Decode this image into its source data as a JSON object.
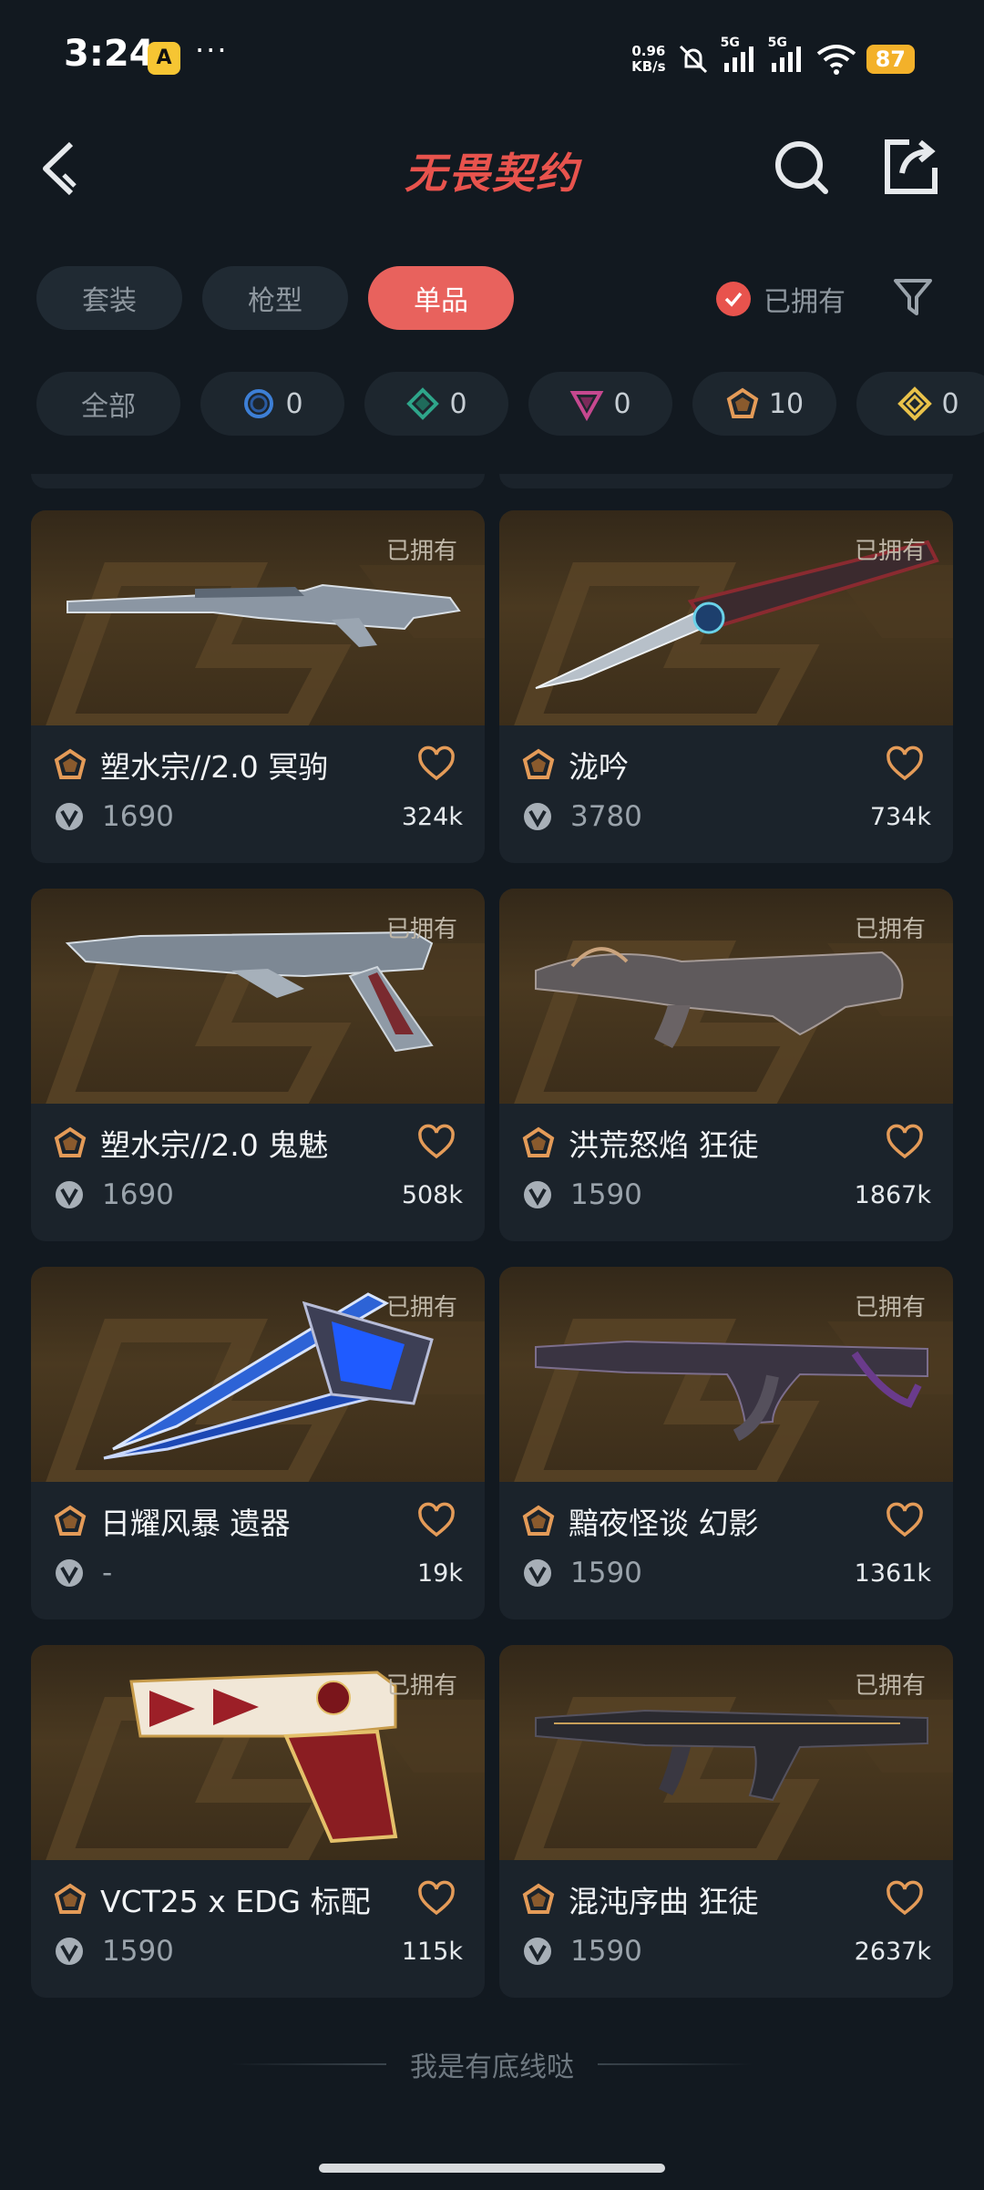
{
  "status_bar": {
    "time": "3:24",
    "app_badge": "A",
    "more": "···",
    "net_speed_value": "0.96",
    "net_speed_unit": "KB/s",
    "signal_1": "5G",
    "signal_2": "5G",
    "battery": "87"
  },
  "header": {
    "title": "无畏契约",
    "brand_color": "#e8534d"
  },
  "tabs": [
    {
      "label": "套装",
      "active": false
    },
    {
      "label": "枪型",
      "active": false
    },
    {
      "label": "单品",
      "active": true
    }
  ],
  "owned_filter": {
    "label": "已拥有",
    "checked": true
  },
  "rarity_filters": [
    {
      "label": "全部"
    },
    {
      "count": "0",
      "icon": "select-tier-icon",
      "color": "#3d7fd6"
    },
    {
      "count": "0",
      "icon": "deluxe-tier-icon",
      "color": "#2ea58a"
    },
    {
      "count": "0",
      "icon": "premium-tier-icon",
      "color": "#c6488f"
    },
    {
      "count": "10",
      "icon": "exclusive-tier-icon",
      "color": "#e49b58"
    },
    {
      "count": "0",
      "icon": "ultra-tier-icon",
      "color": "#e9c24a"
    }
  ],
  "items": [
    {
      "name": "塑水宗//2.0 冥驹",
      "price": "1690",
      "likes": "324k",
      "owned_tag": "已拥有",
      "weapon": "sniper-rifle"
    },
    {
      "name": "泷吟",
      "price": "3780",
      "likes": "734k",
      "owned_tag": "已拥有",
      "weapon": "knife"
    },
    {
      "name": "塑水宗//2.0 鬼魅",
      "price": "1690",
      "likes": "508k",
      "owned_tag": "已拥有",
      "weapon": "pistol"
    },
    {
      "name": "洪荒怒焰 狂徒",
      "price": "1590",
      "likes": "1867k",
      "owned_tag": "已拥有",
      "weapon": "rifle"
    },
    {
      "name": "日耀风暴 遗器",
      "price": "-",
      "likes": "19k",
      "owned_tag": "已拥有",
      "weapon": "blade"
    },
    {
      "name": "黯夜怪谈 幻影",
      "price": "1590",
      "likes": "1361k",
      "owned_tag": "已拥有",
      "weapon": "rifle-dark"
    },
    {
      "name": "VCT25 x EDG 标配",
      "price": "1590",
      "likes": "115k",
      "owned_tag": "已拥有",
      "weapon": "classic-pistol"
    },
    {
      "name": "混沌序曲 狂徒",
      "price": "1590",
      "likes": "2637k",
      "owned_tag": "已拥有",
      "weapon": "rifle-black"
    }
  ],
  "footer": {
    "text": "我是有底线哒"
  }
}
